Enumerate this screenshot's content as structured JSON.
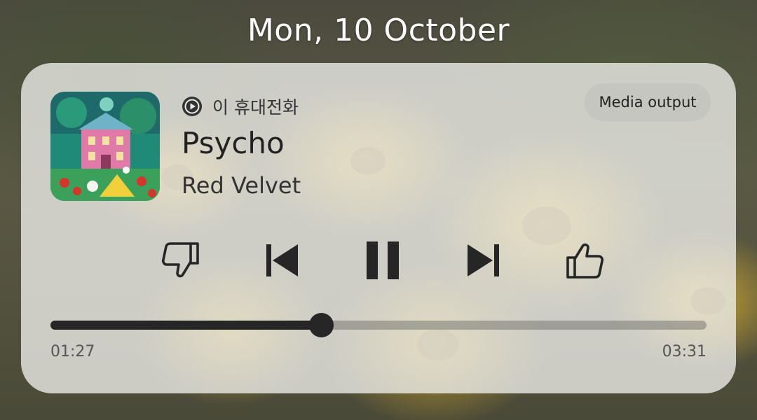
{
  "lockscreen": {
    "date": "Mon, 10 October"
  },
  "media_player": {
    "source_label": "이 휴대전화",
    "output_button_label": "Media output",
    "track": {
      "title": "Psycho",
      "artist": "Red Velvet"
    },
    "playback": {
      "state": "playing",
      "elapsed": "01:27",
      "duration": "03:31",
      "progress_fraction": 0.4123
    },
    "controls": [
      {
        "name": "dislike",
        "icon": "thumbs-down-icon"
      },
      {
        "name": "previous",
        "icon": "skip-previous-icon"
      },
      {
        "name": "pause",
        "icon": "pause-icon"
      },
      {
        "name": "next",
        "icon": "skip-next-icon"
      },
      {
        "name": "like",
        "icon": "thumbs-up-icon"
      }
    ]
  },
  "colors": {
    "control_icon": "#262626",
    "progress_played": "#262626",
    "card_background": "#ececE8"
  }
}
